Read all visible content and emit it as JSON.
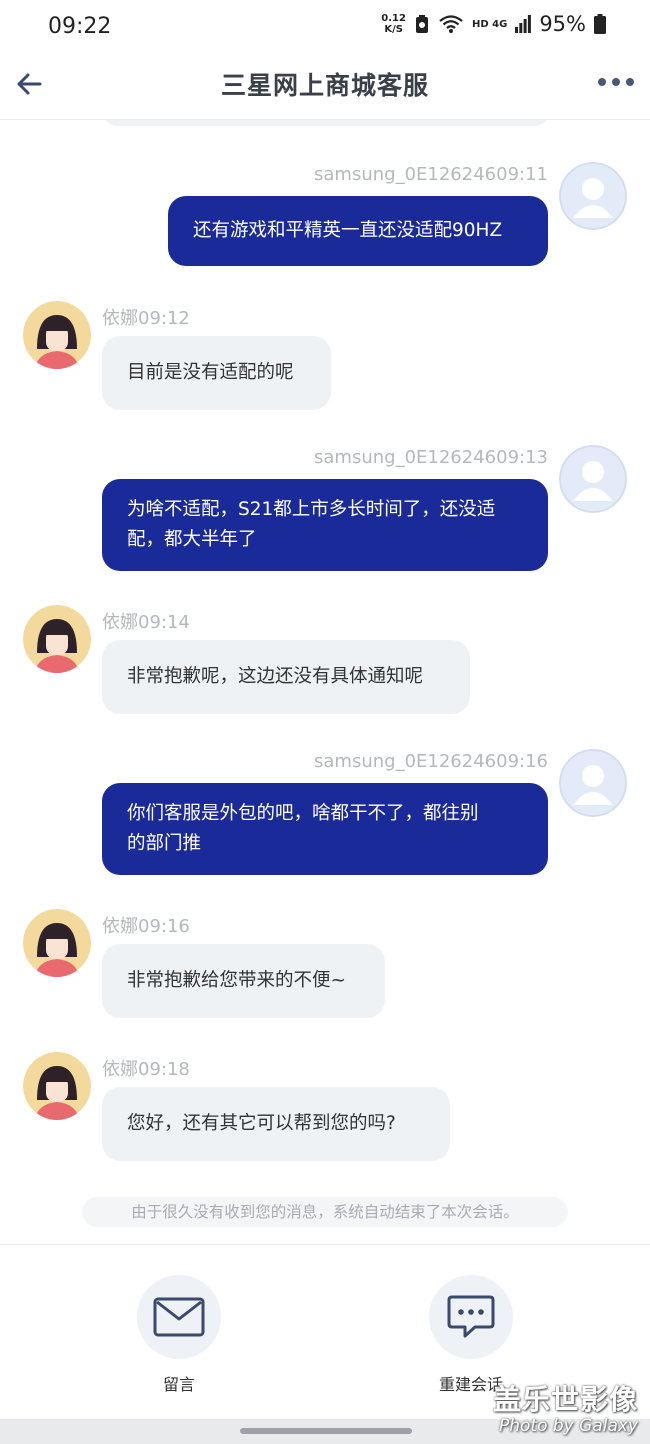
{
  "status_bar": {
    "time": "09:22",
    "speed_value": "0.12",
    "speed_unit": "K/S",
    "network": "HD 4G",
    "battery": "95%"
  },
  "header": {
    "title": "三星网上商城客服",
    "back_icon": "arrow-left-icon",
    "more_icon": "more-horizontal-icon"
  },
  "messages": [
    {
      "direction": "out",
      "sender": "samsung_0E126246",
      "time": "09:11",
      "lines": [
        "还有游戏和平精英一直还没适配90HZ"
      ]
    },
    {
      "direction": "in",
      "sender": "依娜",
      "time": "09:12",
      "lines": [
        "目前是没有适配的呢"
      ]
    },
    {
      "direction": "out",
      "sender": "samsung_0E126246",
      "time": "09:13",
      "lines": [
        "为啥不适配，S21都上市多长时间了，还没适",
        "配，都大半年了"
      ]
    },
    {
      "direction": "in",
      "sender": "依娜",
      "time": "09:14",
      "lines": [
        "非常抱歉呢，这边还没有具体通知呢"
      ]
    },
    {
      "direction": "out",
      "sender": "samsung_0E126246",
      "time": "09:16",
      "lines": [
        "你们客服是外包的吧，啥都干不了，都往别",
        "的部门推"
      ]
    },
    {
      "direction": "in",
      "sender": "依娜",
      "time": "09:16",
      "lines": [
        "非常抱歉给您带来的不便~"
      ]
    },
    {
      "direction": "in",
      "sender": "依娜",
      "time": "09:18",
      "lines": [
        "您好，还有其它可以帮到您的吗?"
      ]
    }
  ],
  "system_note": "由于很久没有收到您的消息，系统自动结束了本次会话。",
  "footer": {
    "leave_message_label": "留言",
    "leave_message_icon": "envelope-icon",
    "restart_chat_label": "重建会话",
    "restart_chat_icon": "chat-bubble-icon"
  },
  "watermark": {
    "line1": "盖乐世影像",
    "line2": "Photo by Galaxy"
  },
  "colors": {
    "outgoing_bubble": "#1a2a98",
    "incoming_bubble": "#eff2f5",
    "meta_text": "#b5b8bd"
  }
}
